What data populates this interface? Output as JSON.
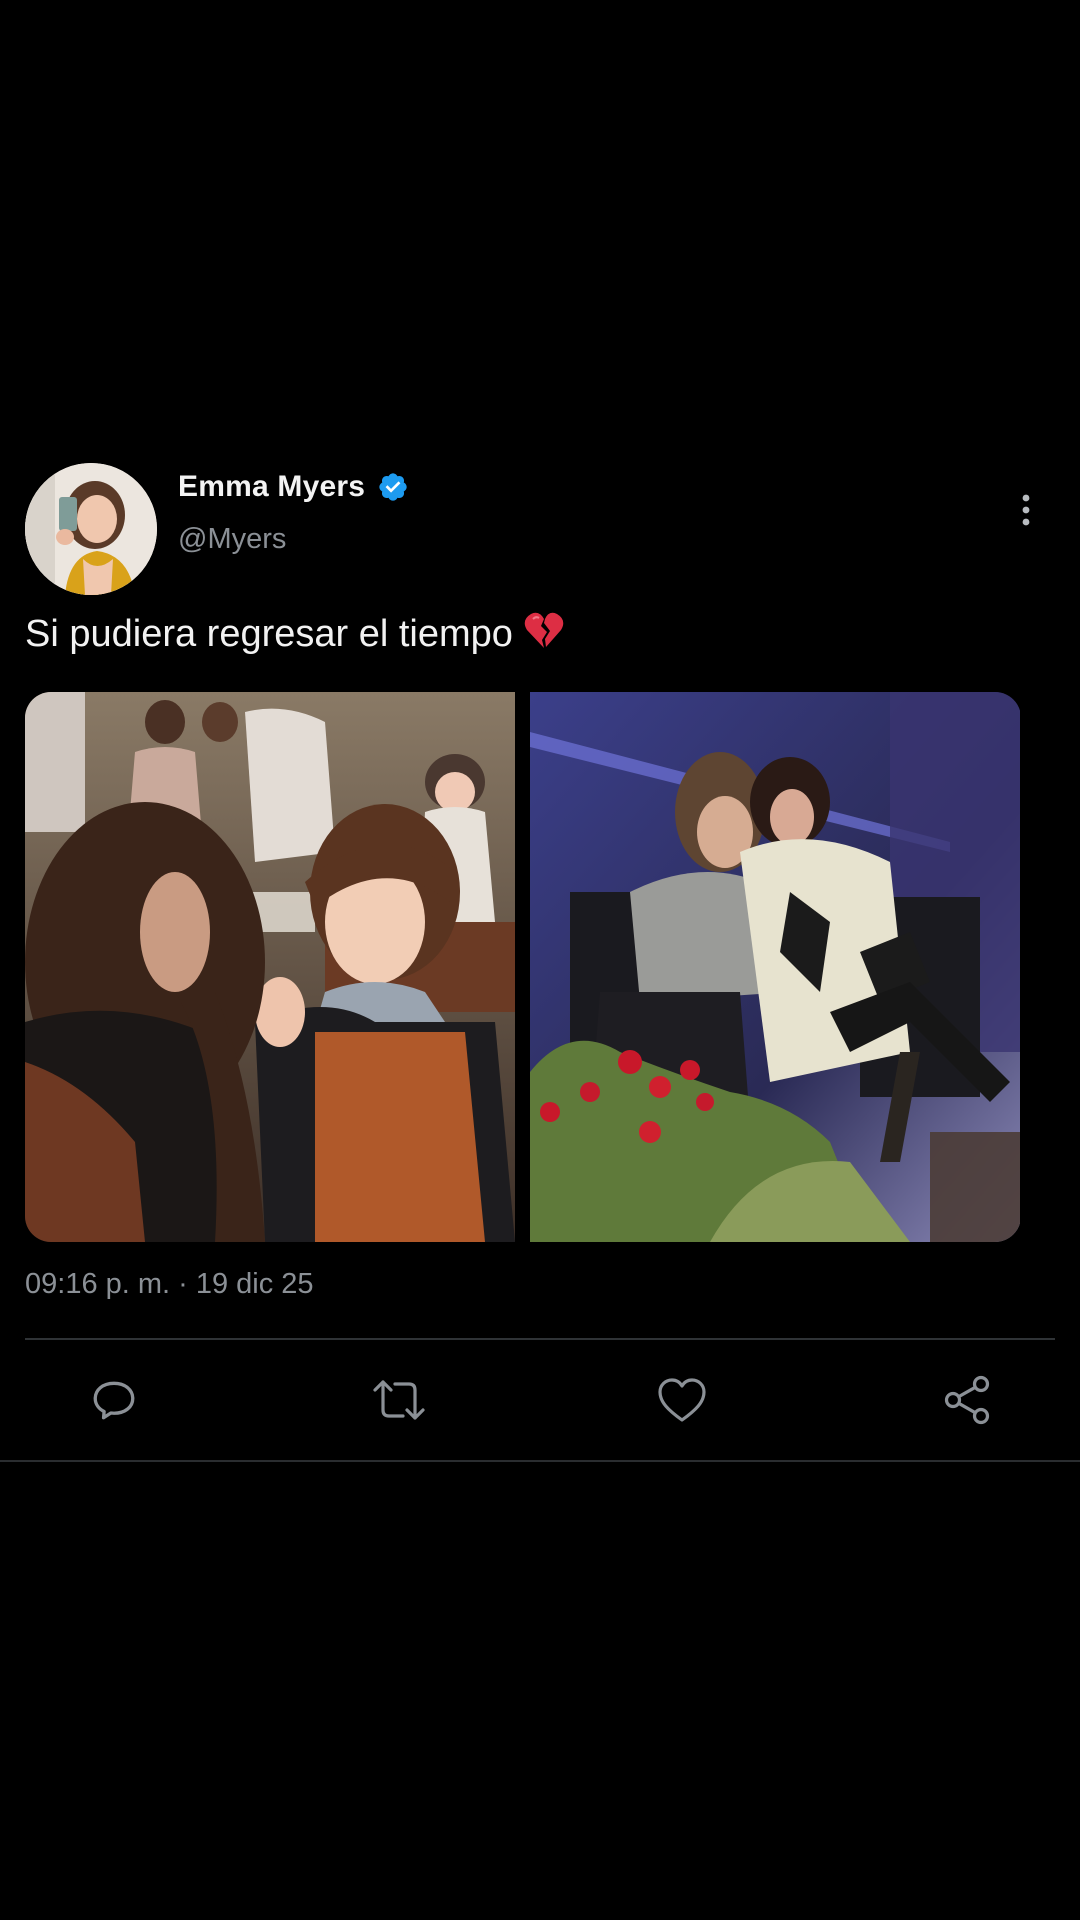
{
  "author": {
    "display_name": "Emma Myers",
    "handle": "@Myers",
    "verified": true,
    "avatar_icon": "profile-photo-selfie"
  },
  "post": {
    "text": "Si pudiera regresar el tiempo",
    "emoji": "broken-heart-icon",
    "timestamp": "09:16 p. m. · 19 dic 25"
  },
  "media": [
    {
      "name": "photo-two-girls-dolls",
      "description_icon": "image"
    },
    {
      "name": "photo-stage-performance",
      "description_icon": "image"
    }
  ],
  "actions": [
    {
      "name": "reply",
      "icon": "comment-icon"
    },
    {
      "name": "repost",
      "icon": "repost-icon"
    },
    {
      "name": "like",
      "icon": "heart-icon"
    },
    {
      "name": "share",
      "icon": "share-icon"
    }
  ],
  "colors": {
    "background": "#000000",
    "text_primary": "#f2f2f2",
    "text_secondary": "#8b9096",
    "verified_blue": "#1d9bf0",
    "divider": "#2f3336",
    "icon_gray": "#8b9096"
  }
}
